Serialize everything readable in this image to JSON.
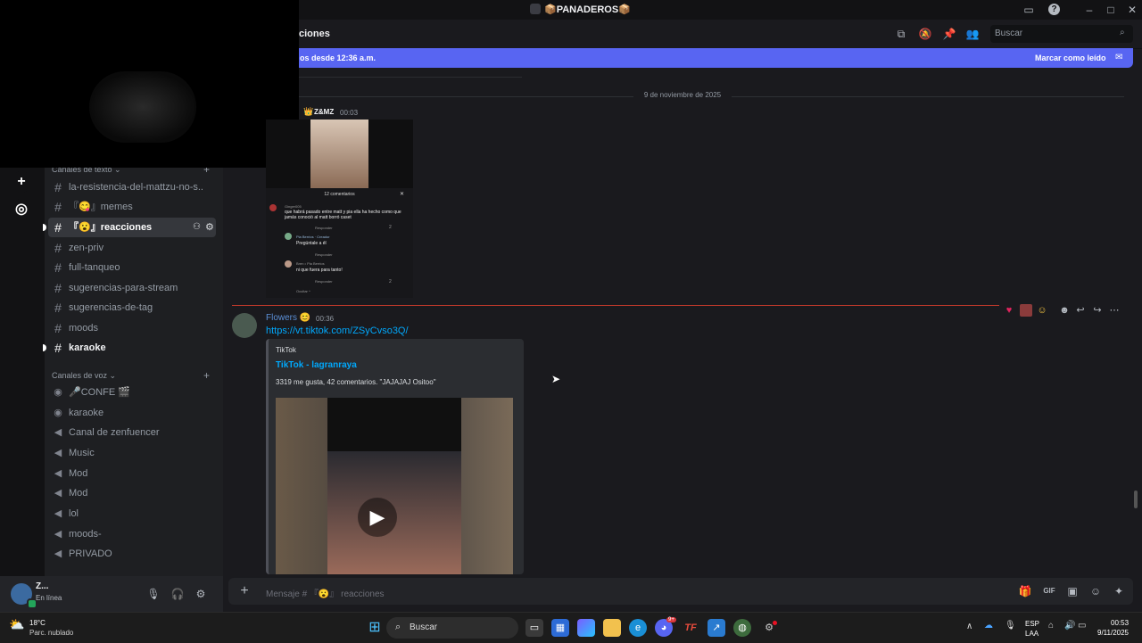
{
  "window": {
    "title": "📦PANADEROS📦",
    "controls": [
      "minimize",
      "maximize",
      "close"
    ]
  },
  "server": {
    "categories": [
      {
        "label": "Canales de texto",
        "plus": "+"
      },
      {
        "label": "Canales de voz",
        "plus": "+"
      }
    ],
    "text_channels": [
      {
        "label": "la-resistencia-del-mattzu-no-s..."
      },
      {
        "label": "『😋』memes"
      },
      {
        "label": "『😮』reacciones"
      },
      {
        "label": "zen-priv"
      },
      {
        "label": "full-tanqueo"
      },
      {
        "label": "sugerencias-para-stream"
      },
      {
        "label": "sugerencias-de-tag"
      },
      {
        "label": "moods"
      },
      {
        "label": "karaoke"
      }
    ],
    "voice_channels": [
      {
        "label": "🎤CONFE 🎬"
      },
      {
        "label": "karaoke"
      },
      {
        "label": "Canal de zenfuencer"
      },
      {
        "label": "Music"
      },
      {
        "label": "Mod"
      },
      {
        "label": "Mod"
      },
      {
        "label": "lol"
      },
      {
        "label": "moods-"
      },
      {
        "label": "PRIVADO"
      }
    ]
  },
  "user": {
    "name": "Z...",
    "status": "En línea"
  },
  "channel": {
    "name_partial": "ciones",
    "search_placeholder": "Buscar"
  },
  "new_messages_bar": {
    "text": "os desde 12:36 a.m.",
    "action": "Marcar como leído"
  },
  "date_separator": "9 de noviembre de 2025",
  "messages": [
    {
      "author": "Z&MZ",
      "time": "00:03",
      "attachment": {
        "comments_header": "12 comentarios",
        "comments": [
          {
            "user": "Ginger005",
            "text": "que habrá pasado entre matt y pia ella ha hecho como que jamás conoció al matt borró caset",
            "reply": "Responder",
            "likes": "2"
          },
          {
            "user": "Pia Berrios · Creador",
            "text": "Pregúntale a él",
            "reply": "Responder",
            "likes": ""
          },
          {
            "user": "Bren • Pia Berrios",
            "text": "ni que fuera para tanto!",
            "reply": "Responder",
            "likes": "2"
          }
        ],
        "hide": "Ocultar ^"
      }
    },
    {
      "author": "Flowers 😊",
      "time": "00:36",
      "link": "https://vt.tiktok.com/ZSyCvso3Q/",
      "embed": {
        "provider": "TikTok",
        "title": "TikTok - lagranraya",
        "description": "3319 me gusta, 42 comentarios. \"JAJAJAJ Ositoo\""
      }
    }
  ],
  "composer": {
    "placeholder": "Mensaje # 『😮』 reacciones"
  },
  "taskbar": {
    "weather_temp": "18°C",
    "weather_desc": "Parc. nublado",
    "search_label": "Buscar",
    "lang_top": "ESP",
    "lang_bottom": "LAA",
    "time": "00:53",
    "date": "9/11/2025",
    "discord_badge": "9+"
  }
}
